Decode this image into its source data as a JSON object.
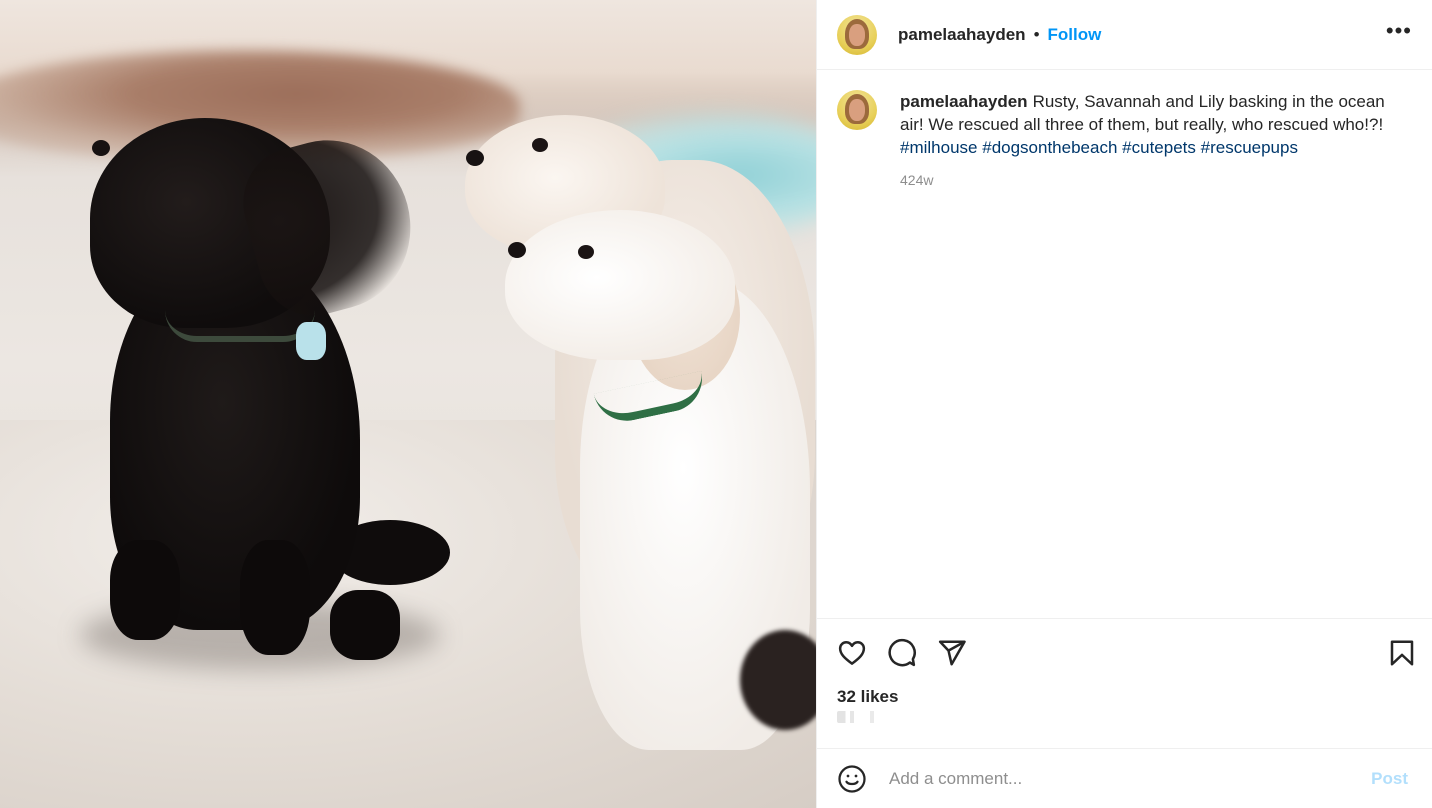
{
  "post": {
    "image_alt": "",
    "author": {
      "username": "pamelaahayden",
      "avatar_icon": "profile-photo-avatar"
    },
    "header": {
      "separator": "•",
      "follow_label": "Follow",
      "more_icon": "more-horizontal-icon",
      "more_glyph": "•••"
    },
    "caption": {
      "username": "pamelaahayden",
      "text": "Rusty, Savannah and Lily basking in the ocean air! We rescued all three of them, but really, who rescued who!?!",
      "hashtags": [
        "#milhouse",
        "#dogsonthebeach",
        "#cutepets",
        "#rescuepups"
      ],
      "timestamp": "424w"
    },
    "actions": {
      "like_icon": "heart-icon",
      "comment_icon": "comment-icon",
      "share_icon": "send-icon",
      "save_icon": "bookmark-icon"
    },
    "likes": "32 likes",
    "comment_bar": {
      "emoji_icon": "emoji-icon",
      "placeholder": "Add a comment...",
      "post_label": "Post"
    },
    "colors": {
      "link_blue": "#0095f6",
      "hashtag": "#00376b",
      "muted": "#8e8e8e",
      "post_disabled": "#b2dffc"
    }
  }
}
